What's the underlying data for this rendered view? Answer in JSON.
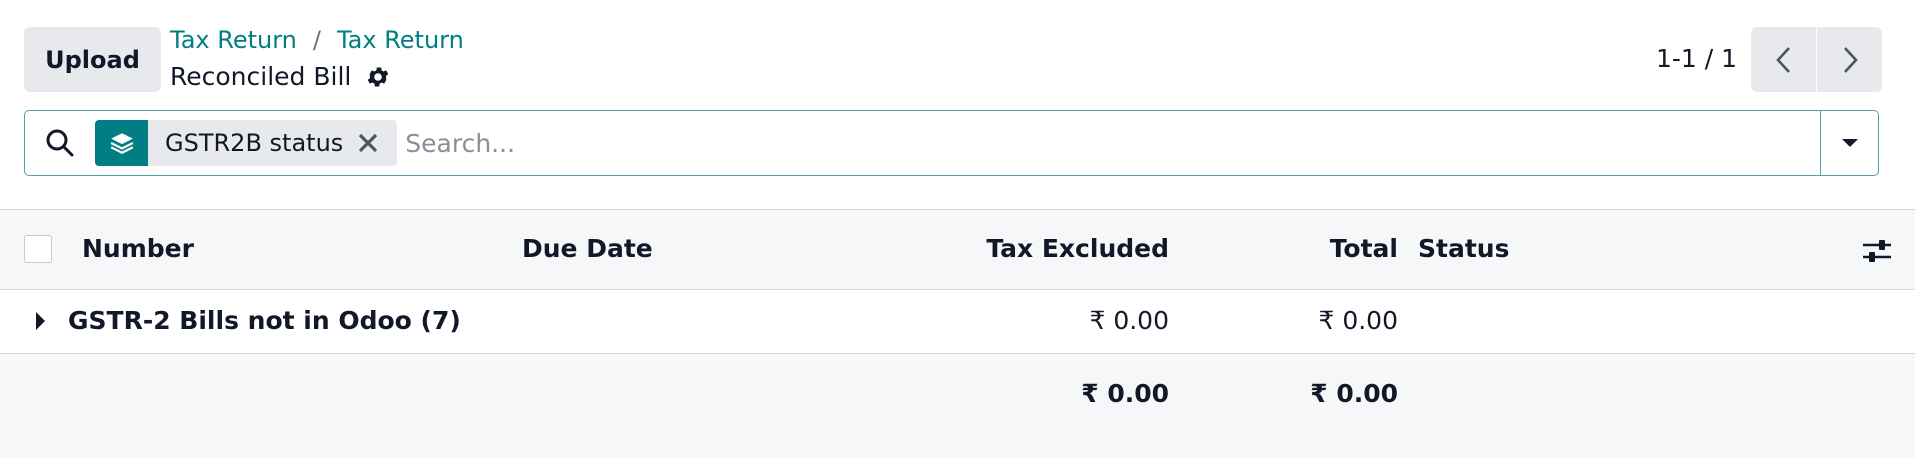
{
  "control_panel": {
    "upload_label": "Upload",
    "breadcrumbs": [
      "Tax Return",
      "Tax Return"
    ],
    "breadcrumb_separator": "/",
    "view_title": "Reconciled Bill",
    "pager_value": "1-1 / 1"
  },
  "search": {
    "facet_label": "GSTR2B status",
    "placeholder": "Search..."
  },
  "list": {
    "columns": {
      "number": "Number",
      "due_date": "Due Date",
      "tax_excluded": "Tax Excluded",
      "total": "Total",
      "status": "Status"
    },
    "groups": [
      {
        "label": "GSTR-2 Bills not in Odoo (7)",
        "tax_excluded": "₹ 0.00",
        "total": "₹ 0.00"
      }
    ],
    "footer": {
      "tax_excluded": "₹ 0.00",
      "total": "₹ 0.00"
    }
  },
  "colors": {
    "brand": "#017e84",
    "button_bg": "#e7e9ed",
    "header_bg": "#f6f7f9"
  },
  "icons": [
    "gear-icon",
    "chevron-left-icon",
    "chevron-right-icon",
    "search-icon",
    "layers-icon",
    "close-icon",
    "caret-down-icon",
    "sliders-icon",
    "caret-right-icon"
  ]
}
